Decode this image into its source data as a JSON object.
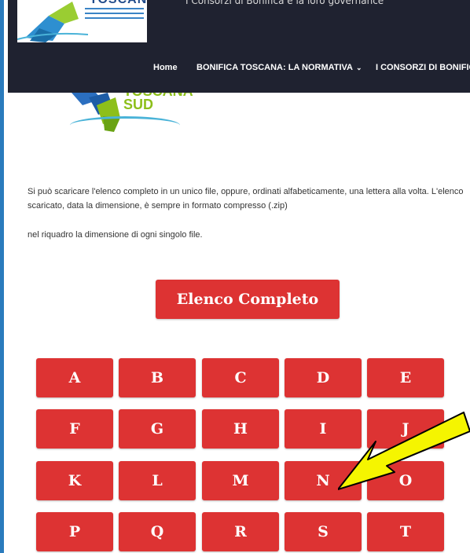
{
  "header": {
    "tagline": "I Consorzi di Bonifica e la loro governance",
    "logo_text": "TOSCANA",
    "nav": [
      {
        "label": "Home"
      },
      {
        "label": "BONIFICA TOSCANA: LA NORMATIVA",
        "has_dropdown": true
      },
      {
        "label": "I CONSORZI DI BONIFIC"
      }
    ]
  },
  "content_logo": {
    "line1": "TOSCANA",
    "line2": "SUD"
  },
  "content": {
    "intro": "Si può scaricare l'elenco completo in un unico file, oppure, ordinati alfabeticamente, una lettera alla volta. L'elenco scaricato, data la dimensione, è sempre in formato compresso (.zip)",
    "note": "nel riquadro la dimensione di ogni singolo file."
  },
  "full_list_button": "Elenco Completo",
  "letters": [
    "A",
    "B",
    "C",
    "D",
    "E",
    "F",
    "G",
    "H",
    "I",
    "J",
    "K",
    "L",
    "M",
    "N",
    "O",
    "P",
    "Q",
    "R",
    "S",
    "T"
  ],
  "colors": {
    "button": "#dd3333",
    "header": "#1f2230",
    "arrow": "#f5f500"
  }
}
